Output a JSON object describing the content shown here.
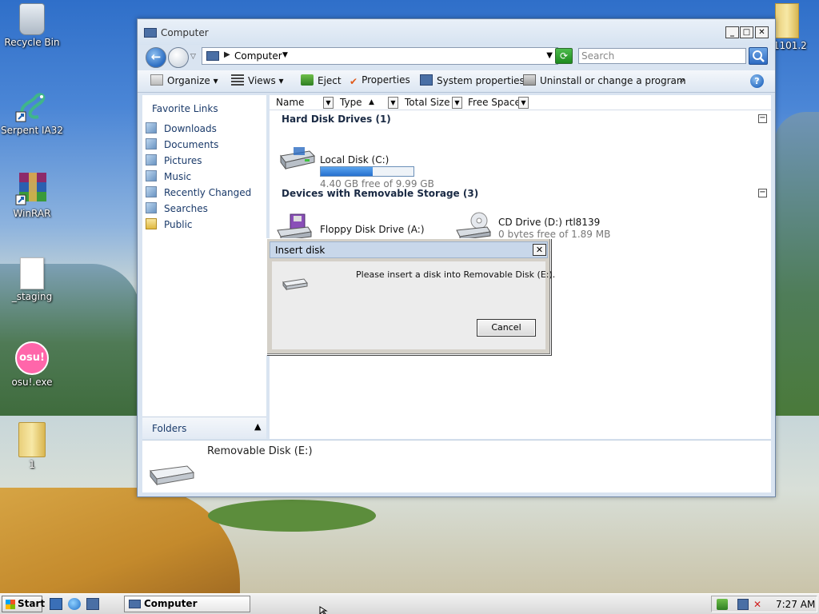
{
  "desktop": {
    "icons": [
      {
        "label": "Recycle Bin"
      },
      {
        "label": "Serpent IA32"
      },
      {
        "label": "WinRAR"
      },
      {
        "label": "_staging"
      },
      {
        "label": "osu!.exe",
        "glyph": "osu!"
      },
      {
        "label": "1"
      },
      {
        "label": "51101.2"
      }
    ]
  },
  "window": {
    "title": "Computer",
    "address": "Computer",
    "search_placeholder": "Search",
    "toolbar": {
      "organize": "Organize",
      "views": "Views",
      "eject": "Eject",
      "properties": "Properties",
      "system_properties": "System properties",
      "uninstall": "Uninstall or change a program",
      "more": "»"
    },
    "nav": {
      "title": "Favorite Links",
      "links": [
        "Downloads",
        "Documents",
        "Pictures",
        "Music",
        "Recently Changed",
        "Searches",
        "Public"
      ],
      "folders_label": "Folders"
    },
    "columns": [
      "Name",
      "Type",
      "Total Size",
      "Free Space"
    ],
    "groups": {
      "hdd": {
        "title": "Hard Disk Drives (1)",
        "drives": [
          {
            "name": "Local Disk (C:)",
            "free": "4.40 GB free of 9.99 GB",
            "used_fraction": 0.56
          }
        ]
      },
      "removable": {
        "title": "Devices with Removable Storage (3)",
        "drives": [
          {
            "name": "Floppy Disk Drive (A:)"
          },
          {
            "name": "CD Drive (D:) rtl8139",
            "free": "0 bytes free of 1.89 MB"
          }
        ]
      }
    },
    "details": {
      "name": "Removable Disk (E:)"
    }
  },
  "dialog": {
    "title": "Insert disk",
    "message": "Please insert a disk into Removable Disk (E:).",
    "cancel_label": "Cancel"
  },
  "taskbar": {
    "start_label": "Start",
    "task_label": "Computer",
    "clock": "7:27 AM"
  }
}
